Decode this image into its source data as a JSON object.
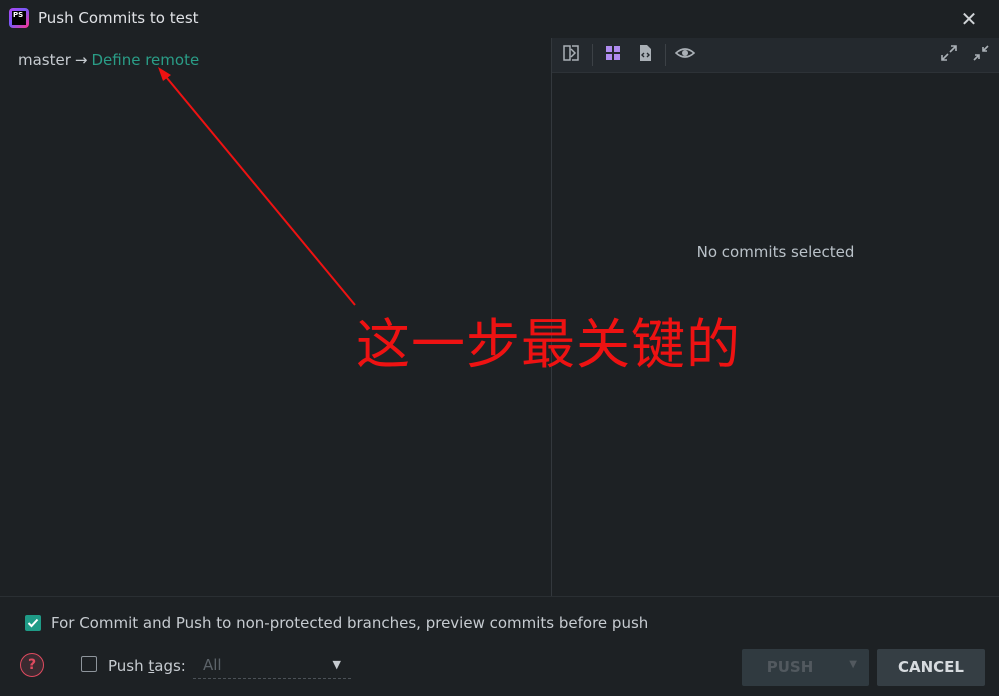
{
  "window": {
    "title": "Push Commits to test",
    "app_logo_text": "PS"
  },
  "branch": {
    "local": "master",
    "arrow": "→",
    "remote_link": "Define remote"
  },
  "right_panel": {
    "empty_message": "No commits selected"
  },
  "options": {
    "preview_before_push_label": "For Commit and Push to non-protected branches, preview commits before push",
    "preview_before_push_checked": true,
    "push_tags_label_pre": "Push ",
    "push_tags_label_mnemonic": "t",
    "push_tags_label_post": "ags:",
    "push_tags_checked": false,
    "push_tags_value": "All"
  },
  "buttons": {
    "push": "PUSH",
    "cancel": "CANCEL"
  },
  "annotation": {
    "text": "这一步最关键的",
    "color": "#ee1212"
  },
  "colors": {
    "accent": "#1f9b87",
    "link": "#2a9d87",
    "background": "#1d2124"
  }
}
